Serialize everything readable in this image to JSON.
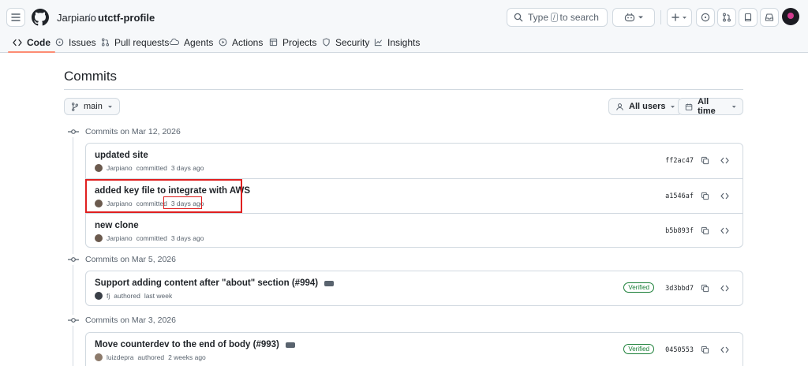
{
  "header": {
    "owner": "Jarpiano",
    "separator": "/",
    "repo": "utctf-profile",
    "search_text_before": "Type",
    "search_key": "/",
    "search_text_after": "to search"
  },
  "nav": {
    "tabs": [
      {
        "label": "Code",
        "icon": "code-icon"
      },
      {
        "label": "Issues",
        "icon": "issue-icon"
      },
      {
        "label": "Pull requests",
        "icon": "pull-request-icon"
      },
      {
        "label": "Agents",
        "icon": "agents-icon"
      },
      {
        "label": "Actions",
        "icon": "play-icon"
      },
      {
        "label": "Projects",
        "icon": "table-icon"
      },
      {
        "label": "Security",
        "icon": "shield-icon"
      },
      {
        "label": "Insights",
        "icon": "graph-icon"
      }
    ]
  },
  "page": {
    "title": "Commits",
    "branch_label": "main",
    "users_filter": "All users",
    "time_filter": "All time"
  },
  "groups": [
    {
      "heading": "Commits on Mar 12, 2026",
      "commits": [
        {
          "title": "updated site",
          "author": "Jarpiano",
          "action": "committed",
          "when": "3 days ago",
          "sha": "ff2ac47",
          "verified": false,
          "has_ellipsis": false
        },
        {
          "title": "added key file to integrate with AWS",
          "author": "Jarpiano",
          "action": "committed",
          "when": "3 days ago",
          "sha": "a1546af",
          "verified": false,
          "has_ellipsis": false
        },
        {
          "title": "new clone",
          "author": "Jarpiano",
          "action": "committed",
          "when": "3 days ago",
          "sha": "b5b893f",
          "verified": false,
          "has_ellipsis": false
        }
      ]
    },
    {
      "heading": "Commits on Mar 5, 2026",
      "commits": [
        {
          "title": "Support adding content after \"about\" section (#994)",
          "author": "fj",
          "action": "authored",
          "when": "last week",
          "sha": "3d3bbd7",
          "verified": true,
          "verified_label": "Verified",
          "has_ellipsis": true
        }
      ]
    },
    {
      "heading": "Commits on Mar 3, 2026",
      "commits": [
        {
          "title": "Move counterdev to the end of body (#993)",
          "author": "luizdepra",
          "action": "authored",
          "when": "2 weeks ago",
          "sha": "0450553",
          "verified": true,
          "verified_label": "Verified",
          "has_ellipsis": true
        }
      ]
    }
  ],
  "colors": {
    "highlight": "#e02020",
    "active_tab_underline": "#fd8c73",
    "verified": "#1a7f37"
  }
}
